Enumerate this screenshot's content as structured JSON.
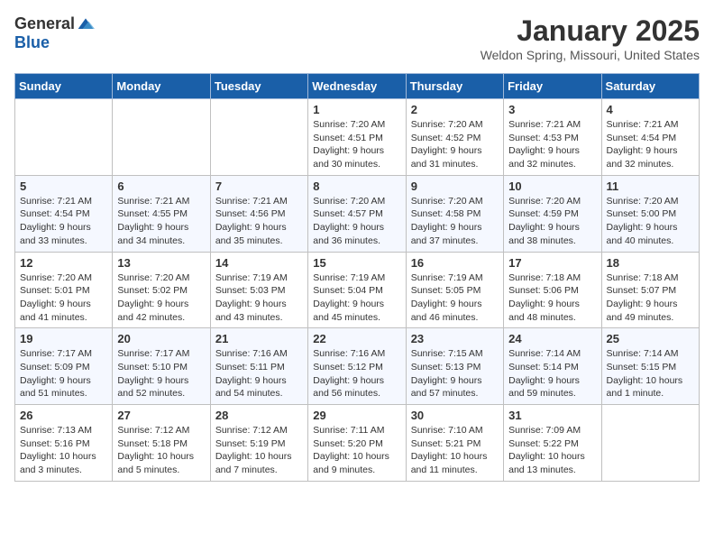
{
  "header": {
    "logo_general": "General",
    "logo_blue": "Blue",
    "month_title": "January 2025",
    "location": "Weldon Spring, Missouri, United States"
  },
  "weekdays": [
    "Sunday",
    "Monday",
    "Tuesday",
    "Wednesday",
    "Thursday",
    "Friday",
    "Saturday"
  ],
  "weeks": [
    [
      {
        "day": "",
        "info": ""
      },
      {
        "day": "",
        "info": ""
      },
      {
        "day": "",
        "info": ""
      },
      {
        "day": "1",
        "info": "Sunrise: 7:20 AM\nSunset: 4:51 PM\nDaylight: 9 hours\nand 30 minutes."
      },
      {
        "day": "2",
        "info": "Sunrise: 7:20 AM\nSunset: 4:52 PM\nDaylight: 9 hours\nand 31 minutes."
      },
      {
        "day": "3",
        "info": "Sunrise: 7:21 AM\nSunset: 4:53 PM\nDaylight: 9 hours\nand 32 minutes."
      },
      {
        "day": "4",
        "info": "Sunrise: 7:21 AM\nSunset: 4:54 PM\nDaylight: 9 hours\nand 32 minutes."
      }
    ],
    [
      {
        "day": "5",
        "info": "Sunrise: 7:21 AM\nSunset: 4:54 PM\nDaylight: 9 hours\nand 33 minutes."
      },
      {
        "day": "6",
        "info": "Sunrise: 7:21 AM\nSunset: 4:55 PM\nDaylight: 9 hours\nand 34 minutes."
      },
      {
        "day": "7",
        "info": "Sunrise: 7:21 AM\nSunset: 4:56 PM\nDaylight: 9 hours\nand 35 minutes."
      },
      {
        "day": "8",
        "info": "Sunrise: 7:20 AM\nSunset: 4:57 PM\nDaylight: 9 hours\nand 36 minutes."
      },
      {
        "day": "9",
        "info": "Sunrise: 7:20 AM\nSunset: 4:58 PM\nDaylight: 9 hours\nand 37 minutes."
      },
      {
        "day": "10",
        "info": "Sunrise: 7:20 AM\nSunset: 4:59 PM\nDaylight: 9 hours\nand 38 minutes."
      },
      {
        "day": "11",
        "info": "Sunrise: 7:20 AM\nSunset: 5:00 PM\nDaylight: 9 hours\nand 40 minutes."
      }
    ],
    [
      {
        "day": "12",
        "info": "Sunrise: 7:20 AM\nSunset: 5:01 PM\nDaylight: 9 hours\nand 41 minutes."
      },
      {
        "day": "13",
        "info": "Sunrise: 7:20 AM\nSunset: 5:02 PM\nDaylight: 9 hours\nand 42 minutes."
      },
      {
        "day": "14",
        "info": "Sunrise: 7:19 AM\nSunset: 5:03 PM\nDaylight: 9 hours\nand 43 minutes."
      },
      {
        "day": "15",
        "info": "Sunrise: 7:19 AM\nSunset: 5:04 PM\nDaylight: 9 hours\nand 45 minutes."
      },
      {
        "day": "16",
        "info": "Sunrise: 7:19 AM\nSunset: 5:05 PM\nDaylight: 9 hours\nand 46 minutes."
      },
      {
        "day": "17",
        "info": "Sunrise: 7:18 AM\nSunset: 5:06 PM\nDaylight: 9 hours\nand 48 minutes."
      },
      {
        "day": "18",
        "info": "Sunrise: 7:18 AM\nSunset: 5:07 PM\nDaylight: 9 hours\nand 49 minutes."
      }
    ],
    [
      {
        "day": "19",
        "info": "Sunrise: 7:17 AM\nSunset: 5:09 PM\nDaylight: 9 hours\nand 51 minutes."
      },
      {
        "day": "20",
        "info": "Sunrise: 7:17 AM\nSunset: 5:10 PM\nDaylight: 9 hours\nand 52 minutes."
      },
      {
        "day": "21",
        "info": "Sunrise: 7:16 AM\nSunset: 5:11 PM\nDaylight: 9 hours\nand 54 minutes."
      },
      {
        "day": "22",
        "info": "Sunrise: 7:16 AM\nSunset: 5:12 PM\nDaylight: 9 hours\nand 56 minutes."
      },
      {
        "day": "23",
        "info": "Sunrise: 7:15 AM\nSunset: 5:13 PM\nDaylight: 9 hours\nand 57 minutes."
      },
      {
        "day": "24",
        "info": "Sunrise: 7:14 AM\nSunset: 5:14 PM\nDaylight: 9 hours\nand 59 minutes."
      },
      {
        "day": "25",
        "info": "Sunrise: 7:14 AM\nSunset: 5:15 PM\nDaylight: 10 hours\nand 1 minute."
      }
    ],
    [
      {
        "day": "26",
        "info": "Sunrise: 7:13 AM\nSunset: 5:16 PM\nDaylight: 10 hours\nand 3 minutes."
      },
      {
        "day": "27",
        "info": "Sunrise: 7:12 AM\nSunset: 5:18 PM\nDaylight: 10 hours\nand 5 minutes."
      },
      {
        "day": "28",
        "info": "Sunrise: 7:12 AM\nSunset: 5:19 PM\nDaylight: 10 hours\nand 7 minutes."
      },
      {
        "day": "29",
        "info": "Sunrise: 7:11 AM\nSunset: 5:20 PM\nDaylight: 10 hours\nand 9 minutes."
      },
      {
        "day": "30",
        "info": "Sunrise: 7:10 AM\nSunset: 5:21 PM\nDaylight: 10 hours\nand 11 minutes."
      },
      {
        "day": "31",
        "info": "Sunrise: 7:09 AM\nSunset: 5:22 PM\nDaylight: 10 hours\nand 13 minutes."
      },
      {
        "day": "",
        "info": ""
      }
    ]
  ]
}
